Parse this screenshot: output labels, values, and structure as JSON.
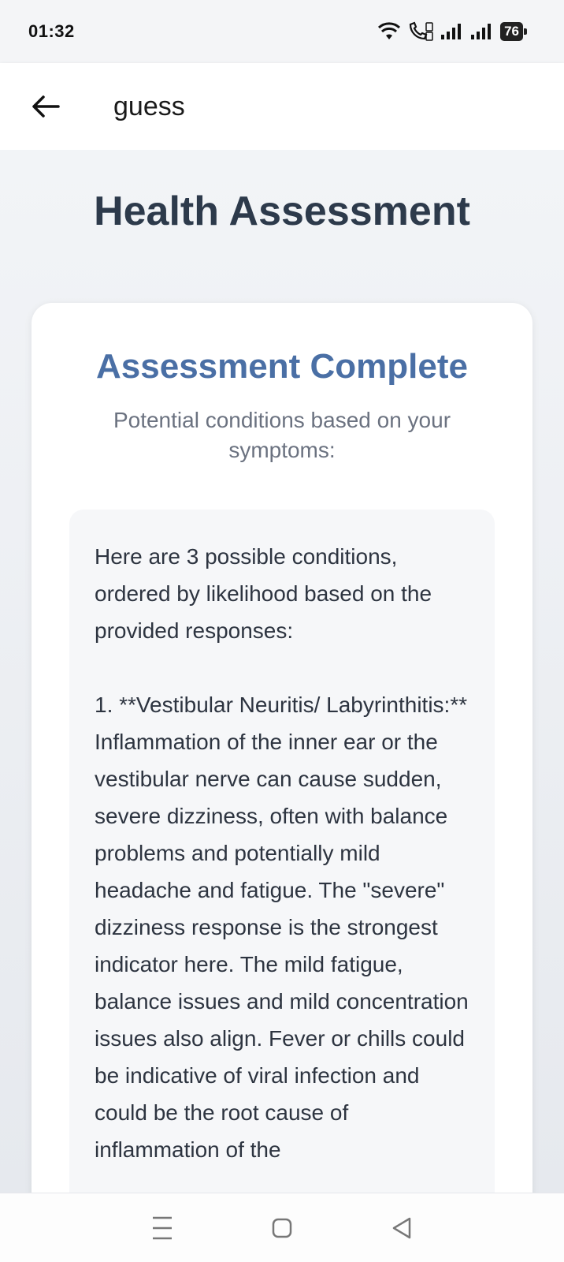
{
  "status_bar": {
    "time": "01:32",
    "battery": "76",
    "icons": [
      "wifi-icon",
      "wifi-calling-icon",
      "signal-icon",
      "signal-icon",
      "battery-icon"
    ]
  },
  "app_bar": {
    "title": "guess",
    "back_icon": "arrow-left-icon"
  },
  "page": {
    "title": "Health Assessment"
  },
  "card": {
    "title": "Assessment Complete",
    "subtitle": "Potential conditions based on your symptoms:",
    "result_text": "Here are 3 possible conditions, ordered by likelihood based on the provided responses:\n\n1.  **Vestibular Neuritis/ Labyrinthitis:** Inflammation of the inner ear or the vestibular nerve can cause sudden, severe dizziness, often with balance problems and potentially mild headache and fatigue. The \"severe\" dizziness response is the strongest indicator here. The mild fatigue, balance issues and mild concentration issues also align. Fever or chills could be indicative of viral infection and could be the root cause of inflammation of the"
  },
  "nav_bar": {
    "icons": [
      "menu-icon",
      "home-icon",
      "back-icon"
    ]
  },
  "colors": {
    "page_title": "#2d3a4b",
    "card_title": "#4a6fa5",
    "subtitle": "#6b7280",
    "background": "#f1f3f6"
  }
}
